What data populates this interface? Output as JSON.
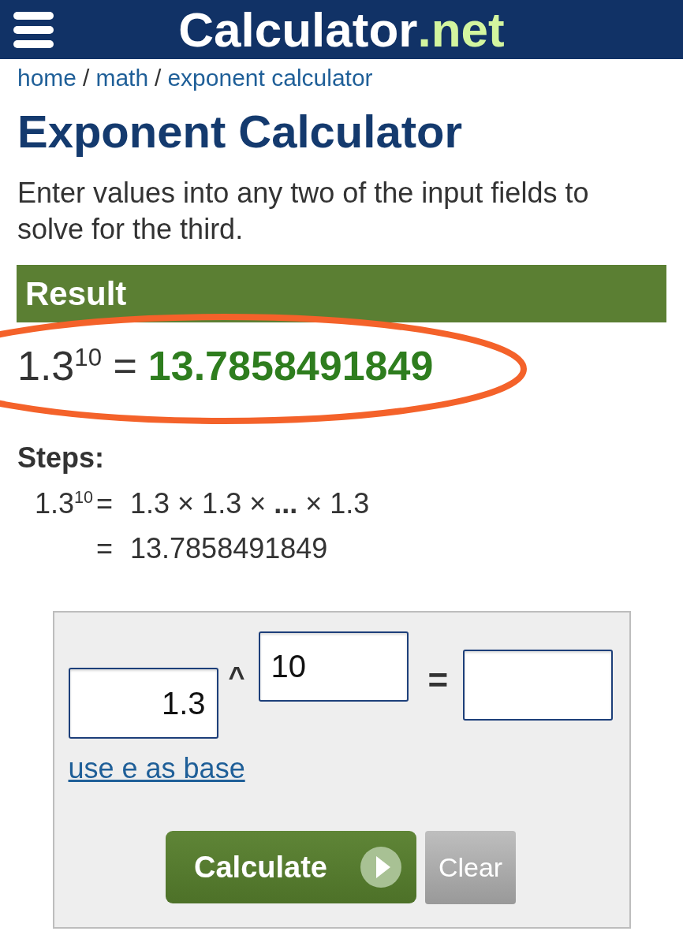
{
  "header": {
    "logo_name": "Calculator",
    "logo_suffix": ".net"
  },
  "breadcrumb": [
    {
      "kind": "link",
      "text": "home"
    },
    {
      "kind": "separator",
      "text": "/"
    },
    {
      "kind": "link",
      "text": "math"
    },
    {
      "kind": "separator",
      "text": "/"
    },
    {
      "kind": "link",
      "text": "exponent calculator"
    }
  ],
  "title": "Exponent Calculator",
  "description": "Enter values into any two of the input fields to solve for the third.",
  "result": {
    "heading": "Result",
    "expression": "1.3$^{10}$ =",
    "value": "13.7858491849",
    "highlighted": true
  },
  "steps": {
    "heading": "Steps:",
    "rows": [
      {
        "lhs": "1.3$^{10}$",
        "op": "=",
        "rhs": "1.3 × 1.3 × **...** × 1.3"
      },
      {
        "op": "=",
        "rhs": "13.7858491849"
      }
    ]
  },
  "form": {
    "base_field": {
      "value": "1.3"
    },
    "power_sign": "^",
    "exponent_field": {
      "value": "10"
    },
    "equals_sign": "=",
    "link": "use e as base",
    "buttons": [
      {
        "kind": "primary",
        "label": "Calculate"
      },
      {
        "kind": "secondary",
        "label": "Clear"
      }
    ]
  }
}
